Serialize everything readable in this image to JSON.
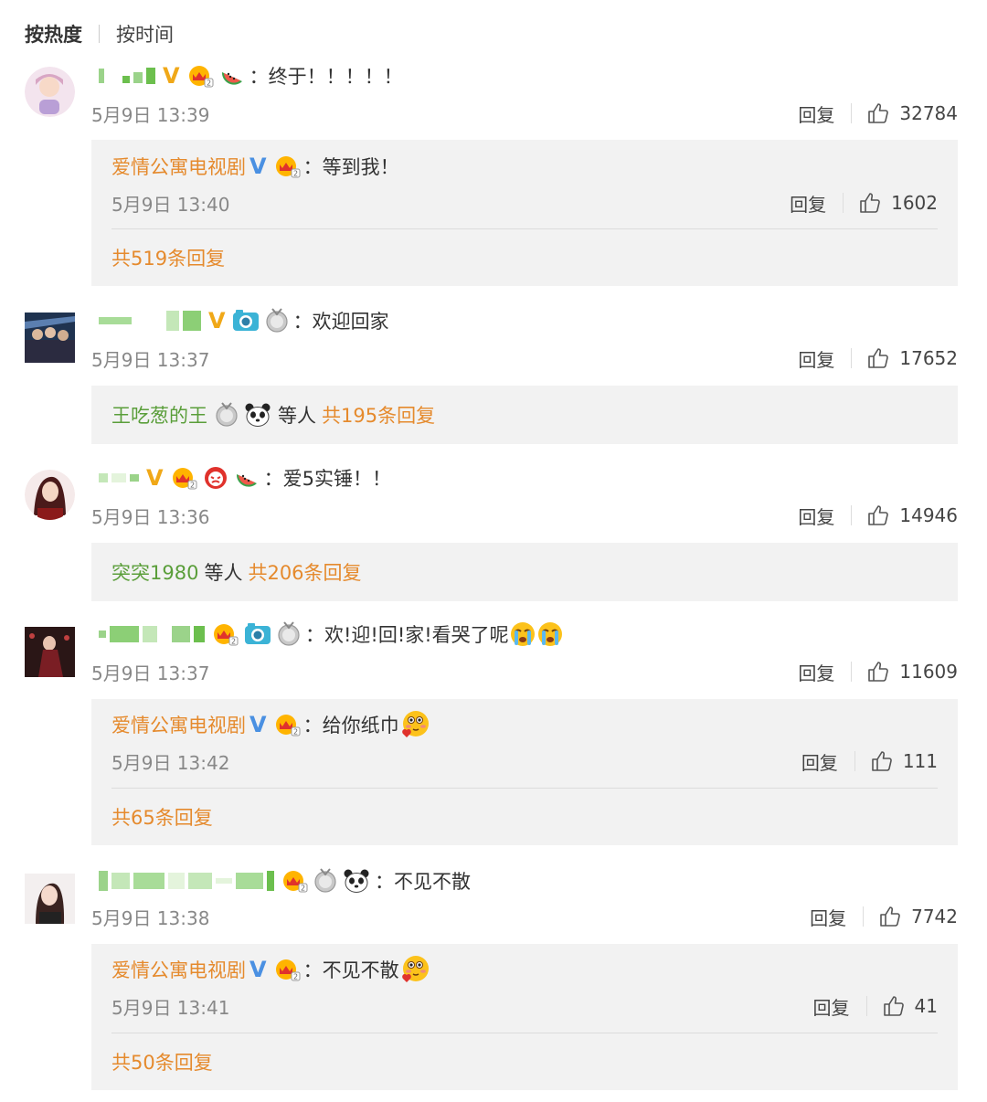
{
  "sort": {
    "hot": "按热度",
    "time": "按时间"
  },
  "colors": {
    "accent": "#e58a2d",
    "vip": "#f0a818",
    "blue_v": "#4a90e2"
  },
  "comments": [
    {
      "text": "：终于！！！！！",
      "time": "5月9日 13:39",
      "reply": "回复",
      "likes": "32784",
      "icons": [
        "pixelated-username",
        "v-badge-icon",
        "crown-level-icon",
        "watermelon-icon"
      ],
      "sub": {
        "name": "爱情公寓电视剧",
        "text": "：等到我！",
        "time": "5月9日 13:40",
        "reply": "回复",
        "likes": "1602",
        "total": "共519条回复"
      }
    },
    {
      "text": "：欢迎回家",
      "time": "5月9日 13:37",
      "reply": "回复",
      "likes": "17652",
      "icons": [
        "pixelated-username",
        "v-badge-icon",
        "camera-icon",
        "medal-icon"
      ],
      "sub_inline": {
        "name": "王吃葱的王",
        "mid": "等人",
        "total": "共195条回复"
      }
    },
    {
      "text": "：爱5实锤！！",
      "time": "5月9日 13:36",
      "reply": "回复",
      "likes": "14946",
      "icons": [
        "pixelated-username",
        "v-badge-icon",
        "crown-level-icon",
        "devil-icon",
        "watermelon-icon"
      ],
      "sub_inline": {
        "name": "突突1980",
        "mid": "等人",
        "total": "共206条回复"
      }
    },
    {
      "text": "：欢!迎!回!家!看哭了呢",
      "time": "5月9日 13:37",
      "reply": "回复",
      "likes": "11609",
      "icons": [
        "pixelated-username",
        "crown-level-icon",
        "camera-icon",
        "medal-icon",
        "crying-face-icon"
      ],
      "sub": {
        "name": "爱情公寓电视剧",
        "text": "：给你纸巾",
        "time": "5月9日 13:42",
        "reply": "回复",
        "likes": "111",
        "total": "共65条回复"
      }
    },
    {
      "text": "：不见不散",
      "time": "5月9日 13:38",
      "reply": "回复",
      "likes": "7742",
      "icons": [
        "pixelated-username",
        "crown-level-icon",
        "medal-icon",
        "panda-icon"
      ],
      "sub": {
        "name": "爱情公寓电视剧",
        "text": "：不见不散",
        "time": "5月9日 13:41",
        "reply": "回复",
        "likes": "41",
        "total": "共50条回复"
      }
    }
  ]
}
